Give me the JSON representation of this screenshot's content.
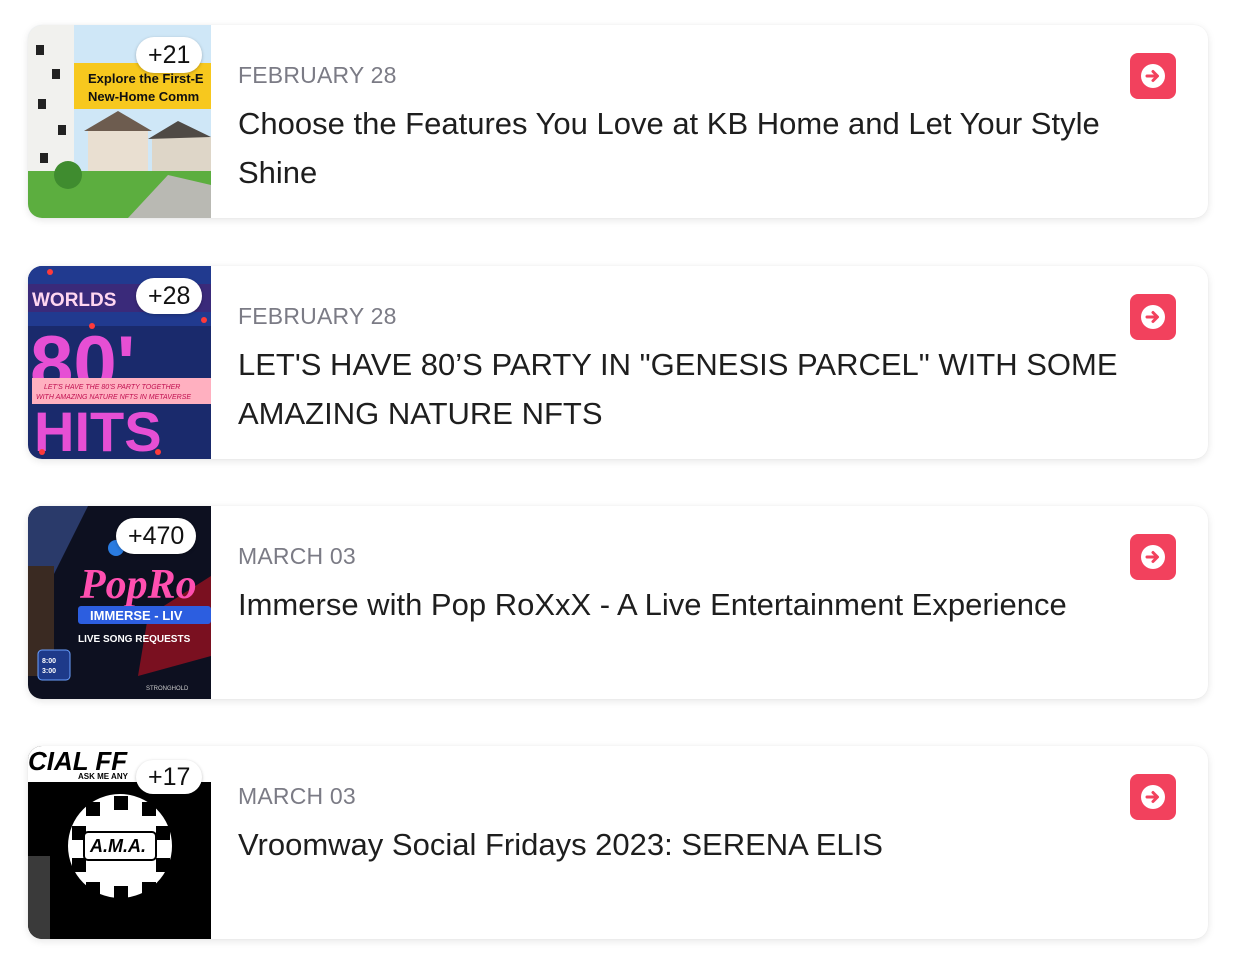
{
  "events": [
    {
      "count": "+21",
      "date": "FEBRUARY 28",
      "title": "Choose the Features You Love at KB Home and Let Your Style Shine",
      "thumb_text": [
        "Explore the First-E",
        "New-Home Comm"
      ]
    },
    {
      "count": "+28",
      "date": "FEBRUARY 28",
      "title": "LET'S HAVE 80’S PARTY IN \"GENESIS PARCEL\" WITH SOME AMAZING NATURE NFTS",
      "thumb_text": [
        "WORLDS",
        "80'",
        "HITS",
        "LET'S HAVE THE 80'S PARTY TOGETHER",
        "WITH AMAZING NATURE NFTS IN METAVERSE"
      ]
    },
    {
      "count": "+470",
      "date": "MARCH 03",
      "title": "Immerse with Pop RoXxX - A Live Entertainment Experience",
      "thumb_text": [
        "PopRo",
        "IMMERSE - LIV",
        "LIVE SONG REQUESTS",
        "8:00",
        "3:00",
        "STRONGHOLD"
      ]
    },
    {
      "count": "+17",
      "date": "MARCH 03",
      "title": "Vroomway Social Fridays 2023: SERENA ELIS",
      "thumb_text": [
        "CIAL FF",
        "ASK ME ANY",
        "A.M.A."
      ]
    }
  ],
  "colors": {
    "accent": "#f2415d",
    "date_text": "#7b7b85",
    "title_text": "#1e1e1e"
  },
  "icons": {
    "go": "arrow-right-circle-icon"
  }
}
